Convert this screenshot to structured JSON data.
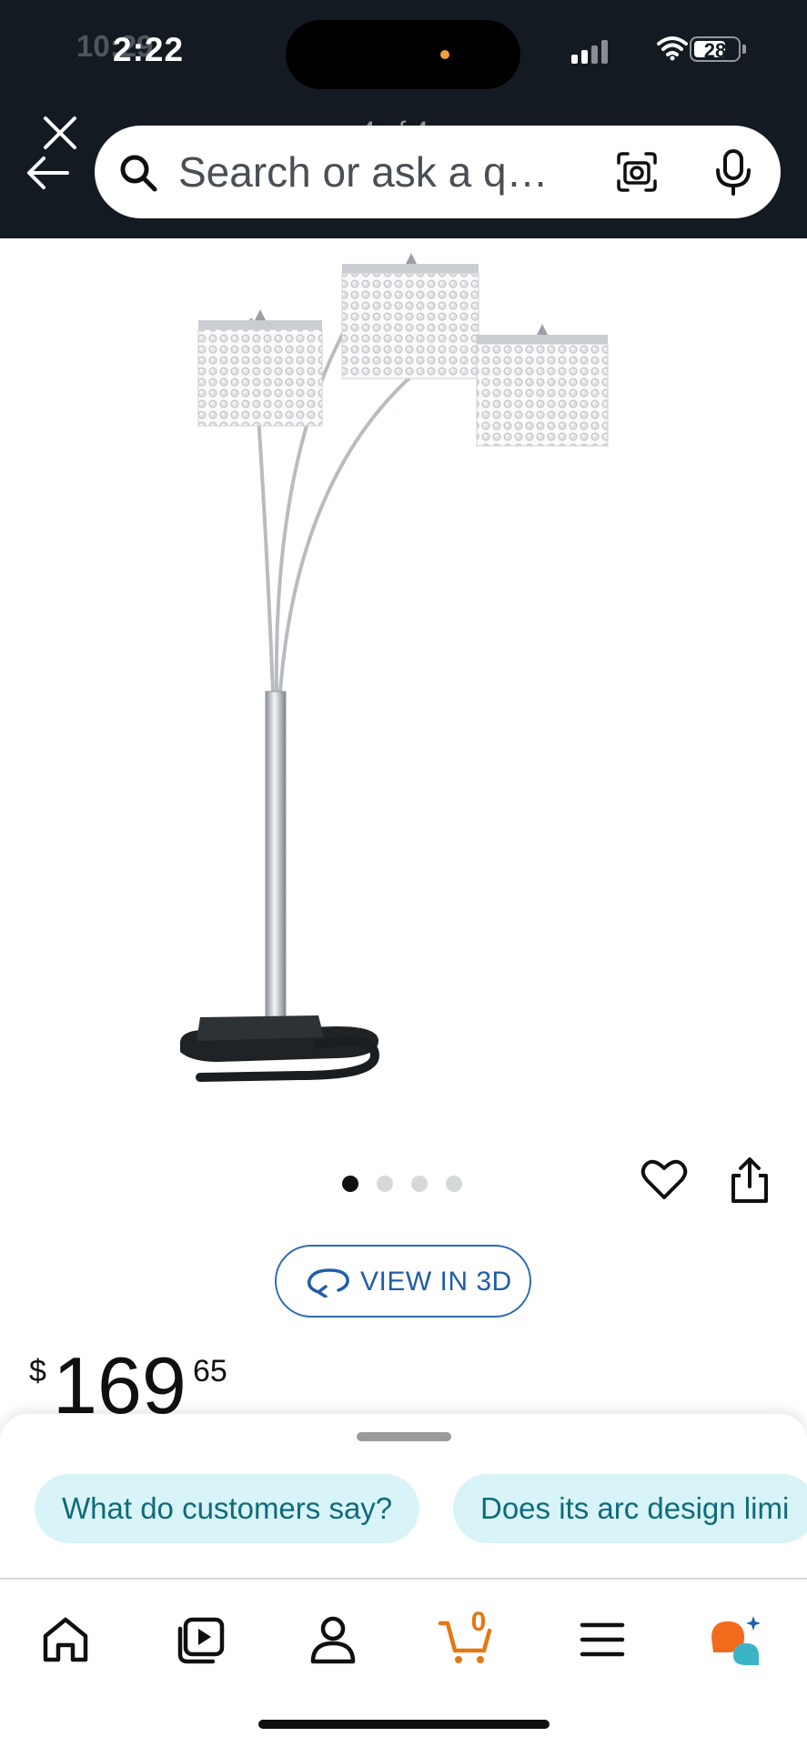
{
  "status_bar": {
    "time": "2:22",
    "time_ghost": "10:29",
    "battery": "28"
  },
  "header": {
    "image_counter": "4 of 4",
    "search_placeholder": "Search or ask a q…"
  },
  "gallery": {
    "total_images": 4,
    "active_index": 0
  },
  "view_3d_label": "VIEW IN 3D",
  "price": {
    "symbol": "$",
    "whole": "169",
    "fraction": "65"
  },
  "suggestions": [
    "What do customers say?",
    "Does its arc design limi"
  ],
  "bottom_nav": {
    "items": [
      "home-icon",
      "video-icon",
      "account-icon",
      "cart-icon",
      "menu-icon",
      "rufus-icon"
    ],
    "cart_count": "0"
  },
  "colors": {
    "header_bg": "#131a22",
    "accent_blue": "#2a6bb3",
    "chip_bg": "#d9f4f8",
    "chip_text": "#0e6b7b",
    "cart_orange": "#e47911"
  }
}
